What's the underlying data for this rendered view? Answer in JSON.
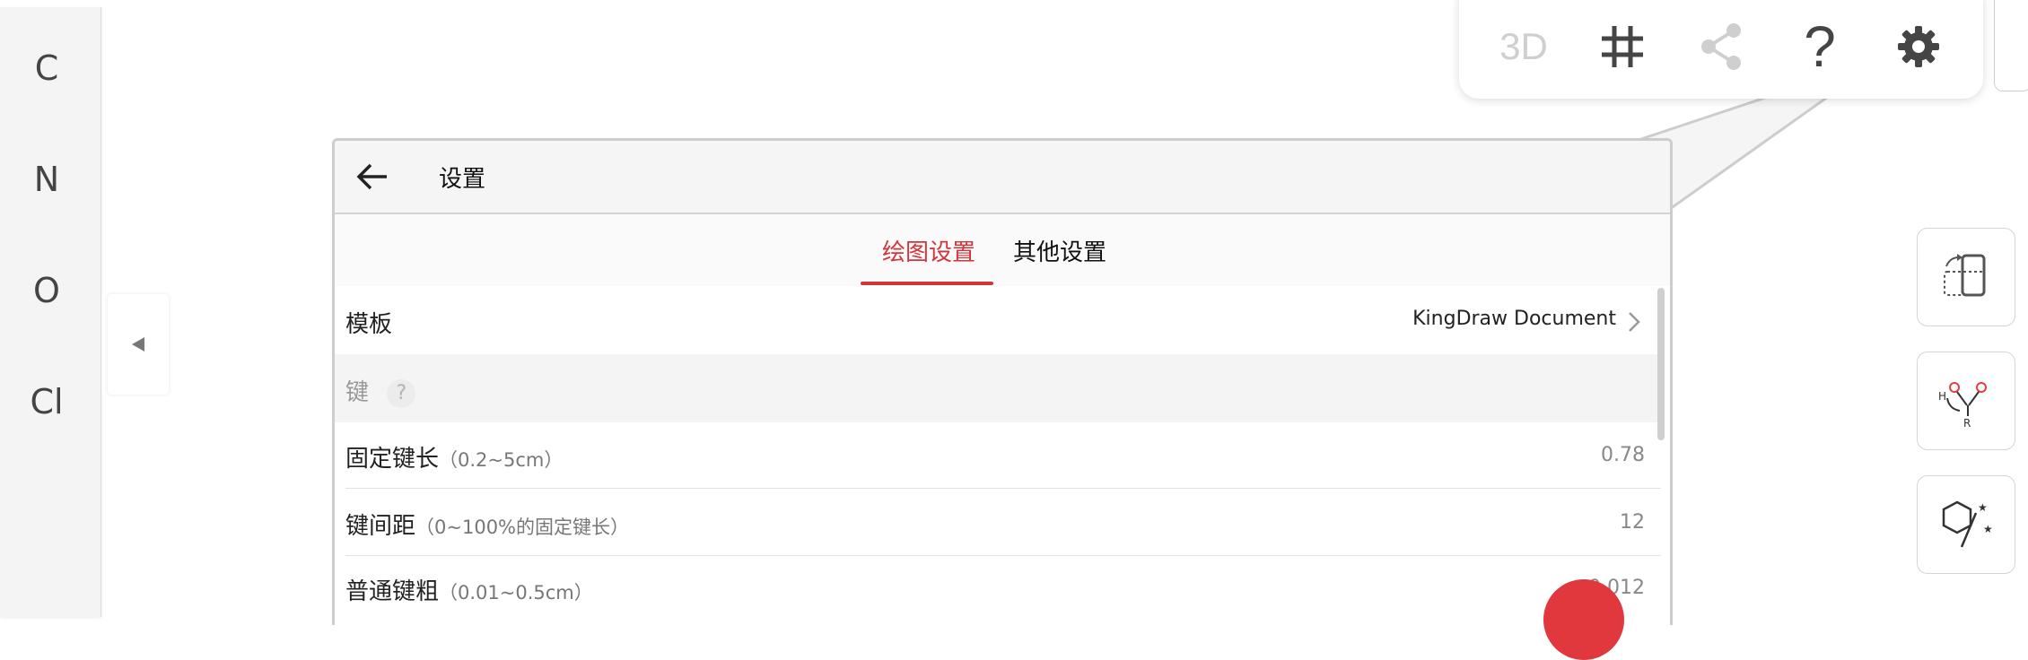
{
  "atoms": [
    "C",
    "N",
    "O",
    "Cl"
  ],
  "toolbar": {
    "btn_3d": "3D",
    "help": "?"
  },
  "dialog": {
    "title": "设置",
    "tabs": [
      "绘图设置",
      "其他设置"
    ],
    "rows": {
      "template": {
        "label": "模板",
        "value": "KingDraw Document"
      },
      "section_bond": {
        "label": "键",
        "help": "?"
      },
      "fixed_length": {
        "label": "固定键长",
        "hint": "（0.2~5cm）",
        "value": "0.78"
      },
      "bond_spacing": {
        "label": "键间距",
        "hint": "（0~100%的固定键长）",
        "value": "12"
      },
      "bond_width": {
        "label": "普通键粗",
        "hint": "（0.01~0.5cm）",
        "value": "0.012"
      }
    }
  },
  "side_tools": {
    "hoh_label_h": "H",
    "hoh_label_r": "R"
  },
  "colors": {
    "accent": "#d0363b",
    "fab": "#e0383c"
  }
}
